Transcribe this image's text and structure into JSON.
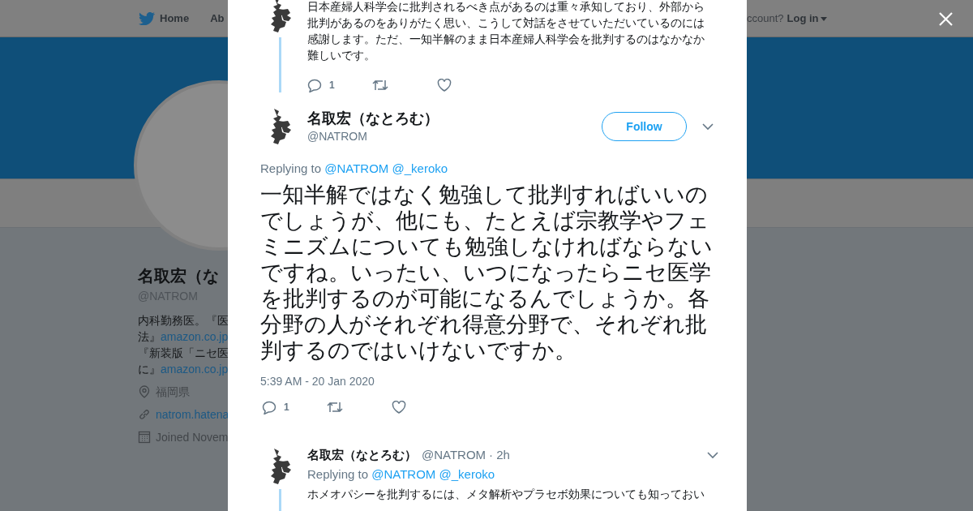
{
  "background_page": {
    "nav": {
      "items": [
        {
          "label": "Home"
        },
        {
          "label": "Ab"
        }
      ],
      "account_prompt": "ccount?",
      "login": "Log in"
    },
    "profile": {
      "name": "名取宏（な",
      "handle": "@NATROM",
      "bio": [
        [
          {
            "kind": "text",
            "text": "内科勤務医。『医"
          }
        ],
        [
          {
            "kind": "text",
            "text": "法』"
          },
          {
            "kind": "link",
            "text": "amazon.co.jp"
          }
        ],
        [
          {
            "kind": "text",
            "text": "『新装版「ニセ医"
          }
        ],
        [
          {
            "kind": "text",
            "text": "に』"
          },
          {
            "kind": "link",
            "text": "amazon.co.jp"
          }
        ]
      ],
      "location": "福岡県",
      "website": "natrom.hatena",
      "joined": "Joined Novem"
    }
  },
  "modal": {
    "tweets": [
      {
        "kind": "compact",
        "text": "日本産婦人科学会に批判されるべき点があるのは重々承知しており、外部から批判があるのをありがたく思い、こうして対話をさせていただいているのには感謝します。ただ、一知半解のまま日本産婦人科学会を批判するのはなかなか難しいです。",
        "thread_line": true,
        "replies": "1"
      },
      {
        "kind": "focused",
        "name": "名取宏（なとろむ）",
        "handle": "@NATROM",
        "follow": "Follow",
        "replying_label": "Replying to",
        "replying_to": [
          "@NATROM",
          "@_keroko"
        ],
        "text": "一知半解ではなく勉強して批判すればいいのでしょうが、他にも、たとえば宗教学やフェミニズムについても勉強しなければならないですね。いったい、いつになったらニセ医学を批判するのが可能になるんでしょうか。各分野の人がそれぞれ得意分野で、それぞれ批判するのではいけないですか。",
        "timestamp": "5:39 AM - 20 Jan 2020",
        "replies": "1"
      },
      {
        "kind": "compact",
        "name": "名取宏（なとろむ）",
        "handle": "@NATROM",
        "time": "· 2h",
        "replying_label": "Replying to",
        "replying_to": [
          "@NATROM",
          "@_keroko"
        ],
        "text": "ホメオパシーを批判するには、メタ解析やプラセボ効果についても知っておい",
        "thread_line": true
      }
    ]
  }
}
